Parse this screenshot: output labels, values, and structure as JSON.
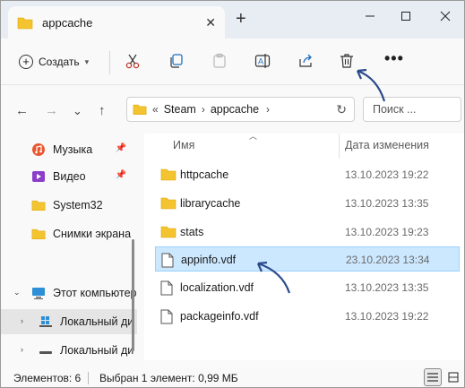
{
  "tab": {
    "title": "appcache"
  },
  "toolbar": {
    "create_label": "Создать"
  },
  "address": {
    "overflow": "«",
    "crumbs": [
      "Steam",
      "appcache"
    ],
    "search_placeholder": "Поиск ..."
  },
  "sidebar": {
    "items": [
      {
        "label": "Музыка",
        "icon": "music-icon",
        "pinned": true
      },
      {
        "label": "Видео",
        "icon": "video-icon",
        "pinned": true
      },
      {
        "label": "System32",
        "icon": "folder-icon",
        "pinned": false
      },
      {
        "label": "Снимки экрана",
        "icon": "folder-icon",
        "pinned": false
      },
      {
        "label": "Этот компьютер",
        "icon": "computer-icon",
        "expanded": true
      },
      {
        "label": "Локальный ди",
        "icon": "windows-drive-icon",
        "selected": true
      },
      {
        "label": "Локальный ди",
        "icon": "drive-icon",
        "selected": false
      }
    ]
  },
  "list": {
    "headers": {
      "name": "Имя",
      "date": "Дата изменения"
    },
    "rows": [
      {
        "name": "httpcache",
        "date": "13.10.2023 19:22",
        "type": "folder"
      },
      {
        "name": "librarycache",
        "date": "13.10.2023 13:35",
        "type": "folder"
      },
      {
        "name": "stats",
        "date": "13.10.2023 19:23",
        "type": "folder"
      },
      {
        "name": "appinfo.vdf",
        "date": "23.10.2023 13:34",
        "type": "file",
        "selected": true
      },
      {
        "name": "localization.vdf",
        "date": "13.10.2023 13:35",
        "type": "file"
      },
      {
        "name": "packageinfo.vdf",
        "date": "13.10.2023 19:22",
        "type": "file"
      }
    ]
  },
  "status": {
    "items_count": "Элементов: 6",
    "selection": "Выбран 1 элемент: 0,99 МБ"
  },
  "colors": {
    "folder": "#f4c430",
    "selection": "#cce8ff",
    "arrow": "#2b4a8c"
  }
}
